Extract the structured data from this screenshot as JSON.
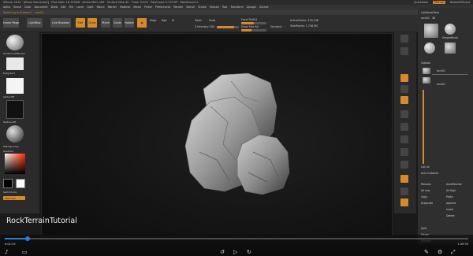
{
  "titlebar": {
    "app_title": "ZBrush 2019 · [Brush Document] · Free Mem 16.729GB · Active Mem 189 · Scratch Disk 45 · Timer 0.003 · PolyCount 5.733 KP · MeshCount 2",
    "quicksave": "QuickSave",
    "menus_label": "Menus",
    "defaultzscript": "DefaultZScript"
  },
  "menubar": [
    "Alpha",
    "Brush",
    "Color",
    "Document",
    "Draw",
    "Edit",
    "File",
    "Layer",
    "Light",
    "Macro",
    "Marker",
    "Material",
    "Movie",
    "Picker",
    "Preferences",
    "Render",
    "Stencil",
    "Stroke",
    "Texture",
    "Tool",
    "Transform",
    "Zplugin",
    "Zscript"
  ],
  "subbar": {
    "hint": "Switching to Subtool 2 · rock01",
    "homepage": "Home Page",
    "lightbox": "LightBox",
    "livebrushes": "Live Boolean"
  },
  "toolbar": {
    "edit_label": "Edit",
    "draw_label": "Draw",
    "move_label": "Move",
    "scale_label": "Scale",
    "rotate_label": "Rotate",
    "mrgb": "Mrgb",
    "rgb": "Rgb",
    "m": "M",
    "zadd": "Zadd",
    "zsub": "Zsub",
    "zintensity": "Z Intensity 100",
    "focal_shift": "Focal Shift 0",
    "draw_size": "Draw Size 64",
    "dynamic": "Dynamic",
    "active_points": "ActivePoints: 378,446",
    "total_points": "TotalPoints: 1.736 Mil"
  },
  "leftpanel": {
    "brush_label": "TrimSmoothBorder",
    "stroke_label": "Drag Rect",
    "alpha_label": "Alpha Off",
    "texture_label": "Texture Off",
    "material_label": "MatCap Gray",
    "gradient_label": "Gradient",
    "switch_label": "SwitchColor",
    "alternate_label": "Alternate"
  },
  "rightpanel": {
    "lightbox_tools": "Lightbox▸Tools",
    "tool_name": "rock01 · 48",
    "subtool_header": "Subtool",
    "subtool1": "rock01",
    "subtool2": "rock02",
    "simple_brush": "SimpleBrush",
    "list_all": "List All",
    "auto_collapse": "Auto Collapse",
    "rename": "Rename",
    "autoreorder": "AutoReorder",
    "all_low": "All Low",
    "all_high": "All High",
    "copy": "Copy",
    "paste": "Paste",
    "duplicate": "Duplicate",
    "append": "Append",
    "insert": "Insert",
    "delete": "Delete",
    "split": "Split",
    "merge": "Merge",
    "boolean": "Boolean"
  },
  "caption": "RockTerrainTutorial",
  "player": {
    "elapsed": "0:02:19",
    "total": "1:49:33",
    "progress": 0.05
  },
  "colors": {
    "accent": "#d88a2a",
    "player_blue": "#2d7dd2",
    "background": "#1a1a1a"
  }
}
